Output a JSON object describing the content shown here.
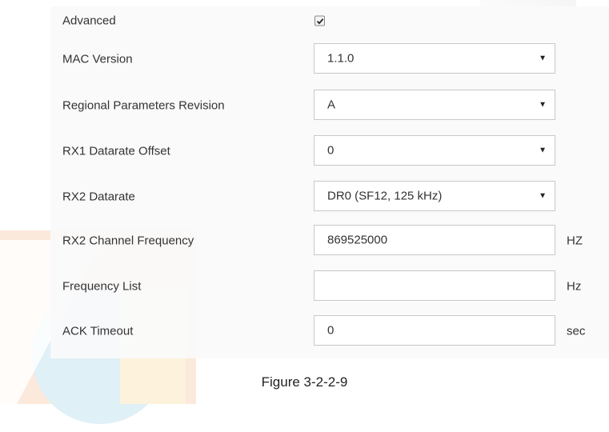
{
  "form": {
    "advanced": {
      "label": "Advanced",
      "checked": true
    },
    "mac_version": {
      "label": "MAC Version",
      "value": "1.1.0"
    },
    "regional_parameters_revision": {
      "label": "Regional Parameters Revision",
      "value": "A"
    },
    "rx1_datarate_offset": {
      "label": "RX1 Datarate Offset",
      "value": "0"
    },
    "rx2_datarate": {
      "label": "RX2 Datarate",
      "value": "DR0 (SF12, 125 kHz)"
    },
    "rx2_channel_frequency": {
      "label": "RX2 Channel Frequency",
      "value": "869525000",
      "unit": "HZ"
    },
    "frequency_list": {
      "label": "Frequency List",
      "value": "",
      "unit": "Hz"
    },
    "ack_timeout": {
      "label": "ACK Timeout",
      "value": "0",
      "unit": "sec"
    }
  },
  "icons": {
    "dropdown": "caret-down-icon",
    "checkbox": "checkmark-icon"
  },
  "caption": "Figure 3-2-2-9"
}
